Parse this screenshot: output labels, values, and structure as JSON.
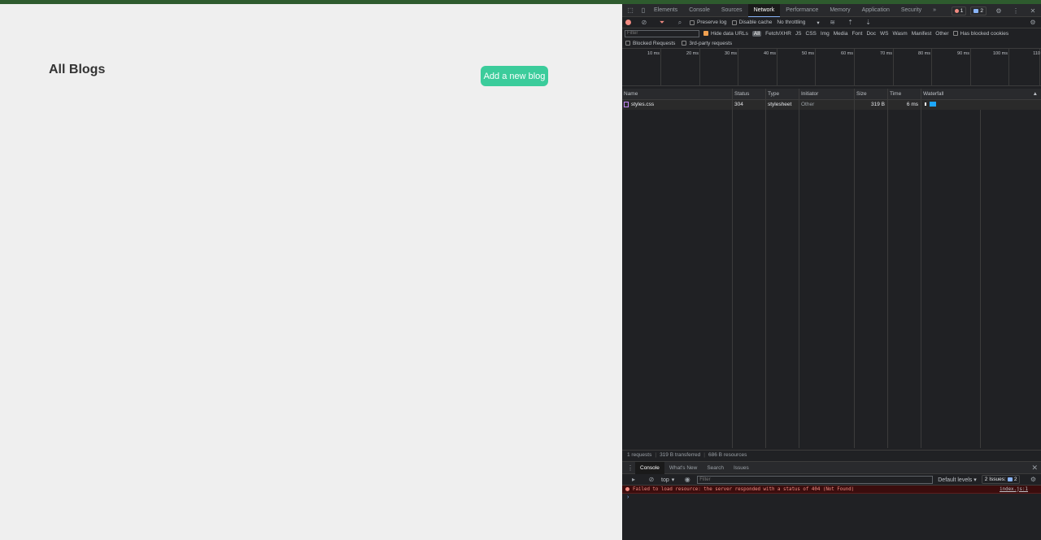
{
  "page": {
    "title": "All Blogs",
    "add_button": "Add a new blog"
  },
  "devtools": {
    "tabs": [
      "Elements",
      "Console",
      "Sources",
      "Network",
      "Performance",
      "Memory",
      "Application",
      "Security"
    ],
    "active_tab": "Network",
    "more": "»",
    "error_count": "1",
    "issue_count": "2",
    "toolbar": {
      "preserve_log": "Preserve log",
      "disable_cache": "Disable cache",
      "throttling": "No throttling"
    },
    "filter": {
      "placeholder": "Filter",
      "hide_data_urls": "Hide data URLs",
      "all": "All",
      "types": [
        "Fetch/XHR",
        "JS",
        "CSS",
        "Img",
        "Media",
        "Font",
        "Doc",
        "WS",
        "Wasm",
        "Manifest",
        "Other"
      ],
      "has_blocked_cookies": "Has blocked cookies",
      "blocked_requests": "Blocked Requests",
      "third_party": "3rd-party requests"
    },
    "timeline_ticks": [
      "10 ms",
      "20 ms",
      "30 ms",
      "40 ms",
      "50 ms",
      "60 ms",
      "70 ms",
      "80 ms",
      "90 ms",
      "100 ms",
      "110"
    ],
    "table": {
      "headers": [
        "Name",
        "Status",
        "Type",
        "Initiator",
        "Size",
        "Time",
        "Waterfall"
      ],
      "rows": [
        {
          "name": "styles.css",
          "status": "304",
          "type": "stylesheet",
          "initiator": "Other",
          "size": "319 B",
          "time": "6 ms"
        }
      ]
    },
    "summary": {
      "requests": "1 requests",
      "transferred": "319 B transferred",
      "resources": "686 B resources"
    },
    "drawer": {
      "tabs": [
        "Console",
        "What's New",
        "Search",
        "Issues"
      ],
      "active_tab": "Console",
      "context": "top",
      "filter_placeholder": "Filter",
      "levels": "Default levels",
      "issues": "2 Issues:",
      "issues_count": "2",
      "error_message": "Failed to load resource: the server responded with a status of 404 (Not Found)",
      "error_source": "index.js:1",
      "prompt": "›"
    },
    "colors": {
      "accent_button": "#3bcc9b",
      "devtools_bg": "#202124",
      "error_text": "#f28b82"
    }
  }
}
